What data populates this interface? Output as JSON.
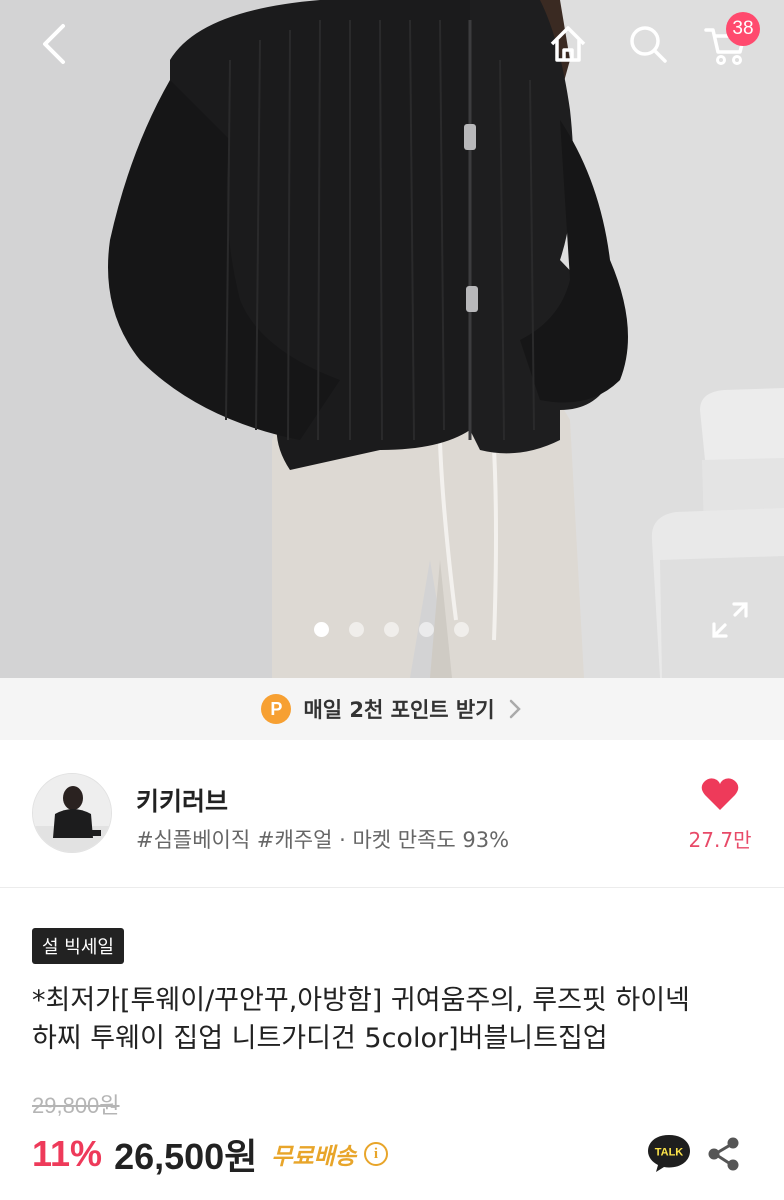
{
  "topbar": {
    "cart_count": "38",
    "icons": [
      "back-icon",
      "home-icon",
      "search-icon",
      "cart-icon"
    ]
  },
  "gallery": {
    "slide_count": 5,
    "active_slide": 1,
    "expand_icon": "expand-icon"
  },
  "points_banner": {
    "icon_letter": "P",
    "text": "매일 2천 포인트 받기"
  },
  "shop": {
    "name": "키키러브",
    "tags": "#심플베이직 #캐주얼 · 마켓 만족도 93%",
    "likes": "27.7만"
  },
  "product": {
    "badge": "설 빅세일",
    "title_line1": "*최저가[투웨이/꾸안꾸,아방함] 귀여움주의, 루즈핏 하이넥",
    "title_line2": "하찌 투웨이 집업 니트가디건 5color]버블니트집업",
    "original_price": "29,800원",
    "discount": "11%",
    "price": "26,500원",
    "shipping": "무료배송",
    "info_glyph": "i",
    "talk_label": "TALK"
  },
  "colors": {
    "accent_pink": "#ee3a5a",
    "badge_pink": "#ff4a6e",
    "points_orange": "#f7a032",
    "shipping_gold": "#e8a52a"
  }
}
